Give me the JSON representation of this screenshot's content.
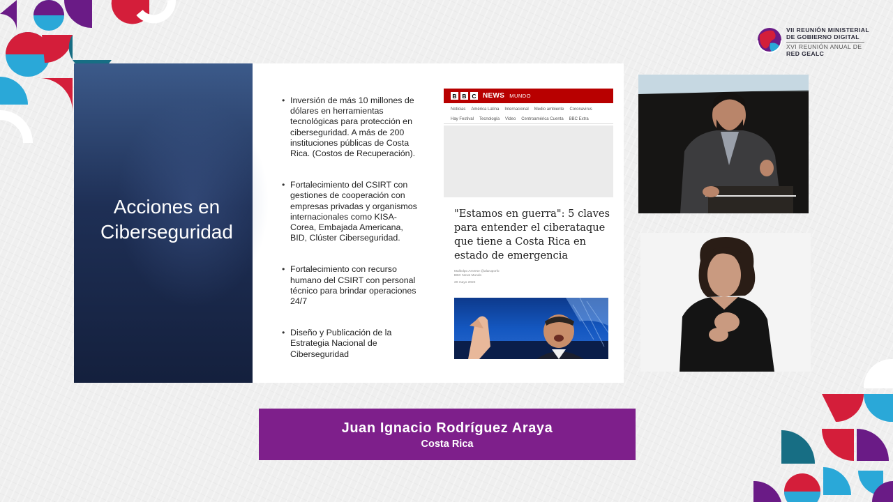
{
  "event_logo": {
    "lines": [
      "VII REUNIÓN MINISTERIAL",
      "DE GOBIERNO DIGITAL",
      "XVI REUNIÓN ANUAL DE",
      "RED GEALC"
    ]
  },
  "slide": {
    "title_line1": "Acciones en",
    "title_line2": "Ciberseguridad",
    "bullets": [
      "Inversión de más 10 millones de dólares en herramientas tecnológicas para protección en ciberseguridad. A más de 200 instituciones públicas de Costa Rica. (Costos de Recuperación).",
      "Fortalecimiento del CSIRT con gestiones de cooperación con empresas privadas y organismos internacionales como KISA-Corea, Embajada Americana, BID, Clúster Ciberseguridad.",
      "Fortalecimiento con recurso humano del CSIRT con personal técnico para brindar operaciones 24/7",
      "Diseño y Publicación de la Estrategia Nacional de Ciberseguridad"
    ],
    "article": {
      "brand_letters": [
        "B",
        "B",
        "C"
      ],
      "brand_news": "NEWS",
      "brand_mundo": "MUNDO",
      "nav": [
        "Noticias",
        "América Latina",
        "Internacional",
        "Medio ambiente",
        "Coronavirus",
        "Hay Festival",
        "Tecnología",
        "Video",
        "Centroamérica Cuenta",
        "BBC Extra"
      ],
      "headline": "\"Estamos en guerra\": 5 claves para entender el ciberataque que tiene a Costa Rica en estado de emergencia",
      "author": "Malkolpo Amerse @alaruporfo",
      "outlet": "BBC News Mundo",
      "date": "20 mayo 2022"
    }
  },
  "lower_third": {
    "name": "Juan Ignacio Rodríguez Araya",
    "country": "Costa Rica"
  },
  "colors": {
    "nameplate": "#7e1f8b",
    "bbc_red": "#b80000",
    "slide_blue": "#1e2f55",
    "deco_purple": "#6a1b86",
    "deco_red": "#d41e3a",
    "deco_cyan": "#2aa8d8",
    "deco_teal": "#176e84"
  },
  "icons": [
    "globe-logo-icon"
  ]
}
